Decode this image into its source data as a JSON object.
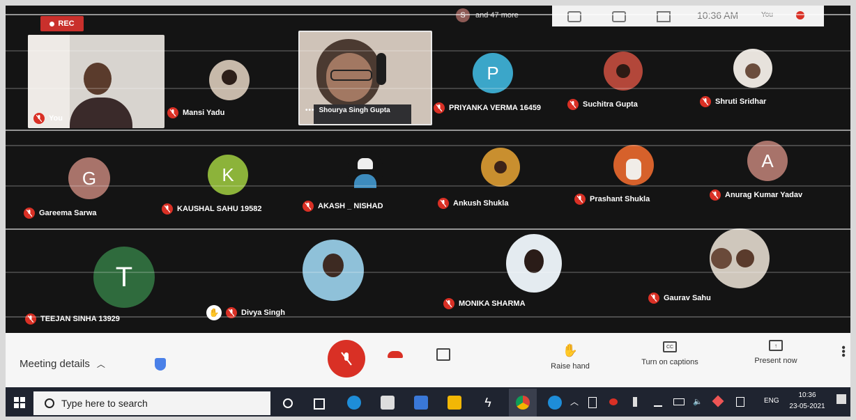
{
  "recording": {
    "label": "REC"
  },
  "topbar": {
    "participants_text": "and 47 more",
    "time": "10:36 AM",
    "you_label": "You"
  },
  "participants": [
    {
      "name": "You",
      "kind": "video"
    },
    {
      "name": "Mansi Yadu",
      "kind": "photo"
    },
    {
      "name": "Shourya Singh Gupta",
      "kind": "video"
    },
    {
      "name": "PRIYANKA VERMA 16459",
      "kind": "letter",
      "letter": "P",
      "color": "#3ba6c9"
    },
    {
      "name": "Suchitra Gupta",
      "kind": "photo"
    },
    {
      "name": "Shruti Sridhar",
      "kind": "photo"
    },
    {
      "name": "Gareema Sarwa",
      "kind": "letter",
      "letter": "G",
      "color": "#a8736a"
    },
    {
      "name": "KAUSHAL SAHU 19582",
      "kind": "letter",
      "letter": "K",
      "color": "#8cb33a"
    },
    {
      "name": "AKASH _ NISHAD",
      "kind": "photo"
    },
    {
      "name": "Ankush Shukla",
      "kind": "photo"
    },
    {
      "name": "Prashant Shukla",
      "kind": "photo"
    },
    {
      "name": "Anurag Kumar Yadav",
      "kind": "letter",
      "letter": "A",
      "color": "#a8736a"
    },
    {
      "name": "TEEJAN SINHA 13929",
      "kind": "letter",
      "letter": "T",
      "color": "#2f6b3d"
    },
    {
      "name": "Divya Singh",
      "kind": "photo"
    },
    {
      "name": "MONIKA SHARMA",
      "kind": "photo"
    },
    {
      "name": "Gaurav Sahu",
      "kind": "photo"
    }
  ],
  "toolbar": {
    "meeting_details": "Meeting details",
    "raise_hand": "Raise hand",
    "captions": "Turn on captions",
    "present": "Present now"
  },
  "taskbar": {
    "search_placeholder": "Type here to search",
    "lang": "ENG",
    "clock_time": "10:36",
    "clock_date": "23-05-2021"
  },
  "colors": {
    "accent_red": "#d93025",
    "dark_bg": "#141414"
  }
}
